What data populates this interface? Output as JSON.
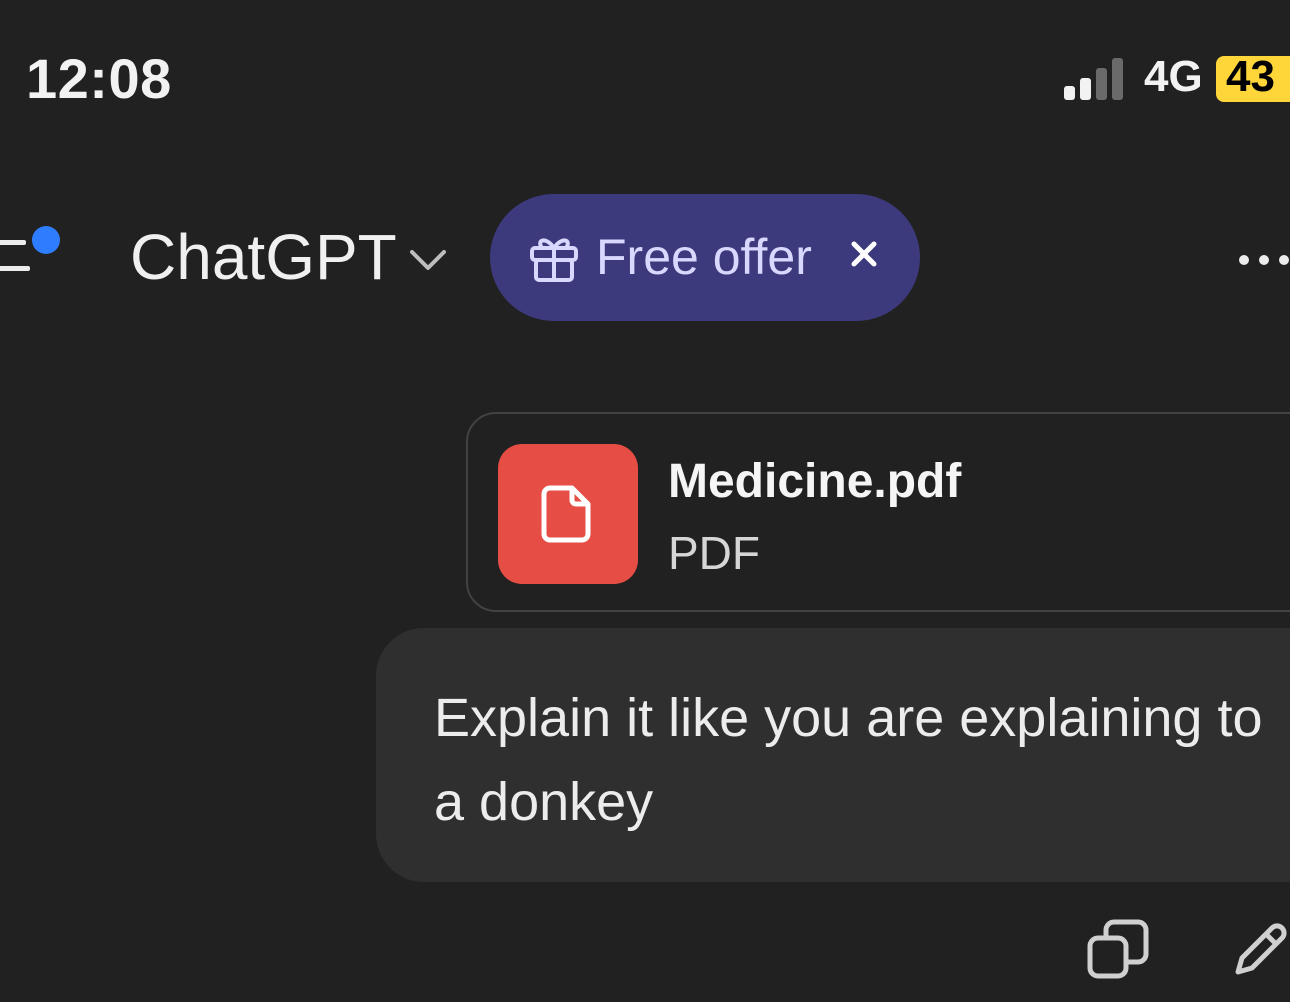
{
  "status_bar": {
    "time": "12:08",
    "network": "4G",
    "battery": "43"
  },
  "header": {
    "title": "ChatGPT",
    "offer_label": "Free offer"
  },
  "conversation": {
    "attachment": {
      "file_name": "Medicine.pdf",
      "file_type": "PDF"
    },
    "user_message": "Explain it like you are explaining to a donkey"
  },
  "colors": {
    "background": "#212121",
    "bubble": "#2f2f2f",
    "offer_pill": "#3c3a7c",
    "pdf_tile": "#e64d44",
    "notification_dot": "#2f7dff",
    "battery": "#ffd63a"
  },
  "icons": [
    "signal-icon",
    "menu-icon",
    "chevron-down-icon",
    "gift-icon",
    "close-icon",
    "more-icon",
    "document-icon",
    "copy-icon",
    "edit-icon"
  ]
}
